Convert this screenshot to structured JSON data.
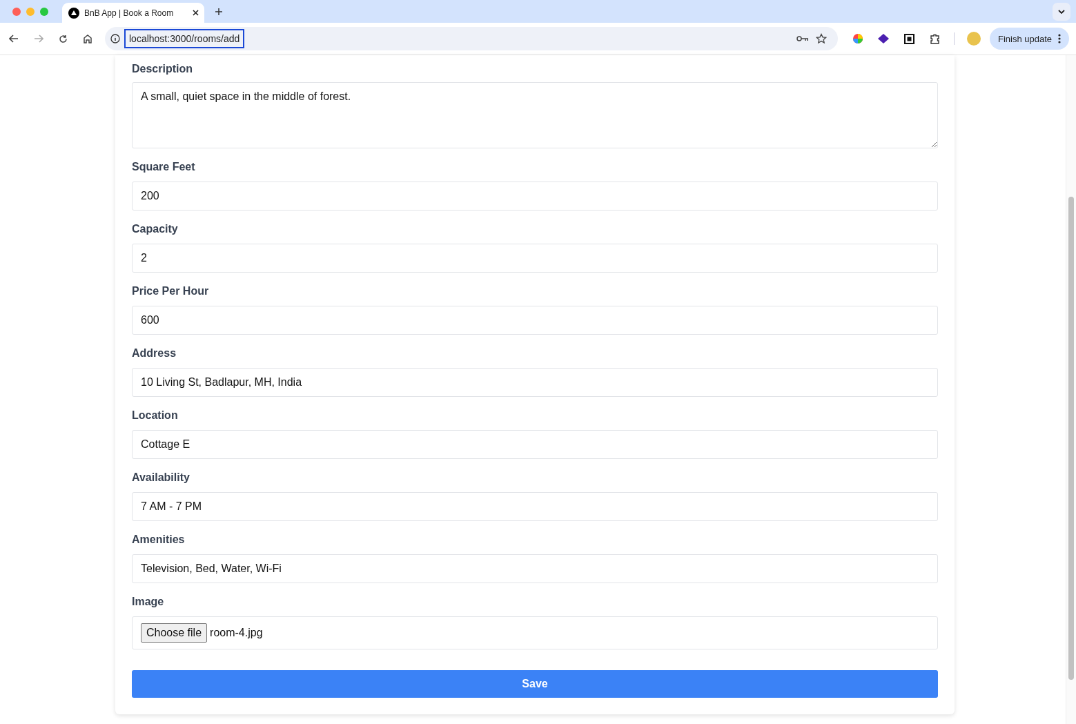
{
  "browser": {
    "tabs": [
      {
        "title": "BnB App | Book a Room",
        "selected": true
      }
    ],
    "url": "localhost:3000/rooms/add",
    "update_button": "Finish update"
  },
  "form": {
    "fields": [
      {
        "kind": "textarea",
        "label": "Description",
        "value": "A small, quiet space in the middle of forest."
      },
      {
        "kind": "text",
        "label": "Square Feet",
        "value": "200"
      },
      {
        "kind": "text",
        "label": "Capacity",
        "value": "2"
      },
      {
        "kind": "text",
        "label": "Price Per Hour",
        "value": "600"
      },
      {
        "kind": "text",
        "label": "Address",
        "value": "10 Living St, Badlapur, MH, India"
      },
      {
        "kind": "text",
        "label": "Location",
        "value": "Cottage E"
      },
      {
        "kind": "text",
        "label": "Availability",
        "value": "7 AM - 7 PM"
      },
      {
        "kind": "text",
        "label": "Amenities",
        "value": "Television, Bed, Water, Wi-Fi"
      },
      {
        "kind": "file",
        "label": "Image",
        "button": "Choose file",
        "value": "room-4.jpg"
      }
    ],
    "submit": "Save"
  }
}
